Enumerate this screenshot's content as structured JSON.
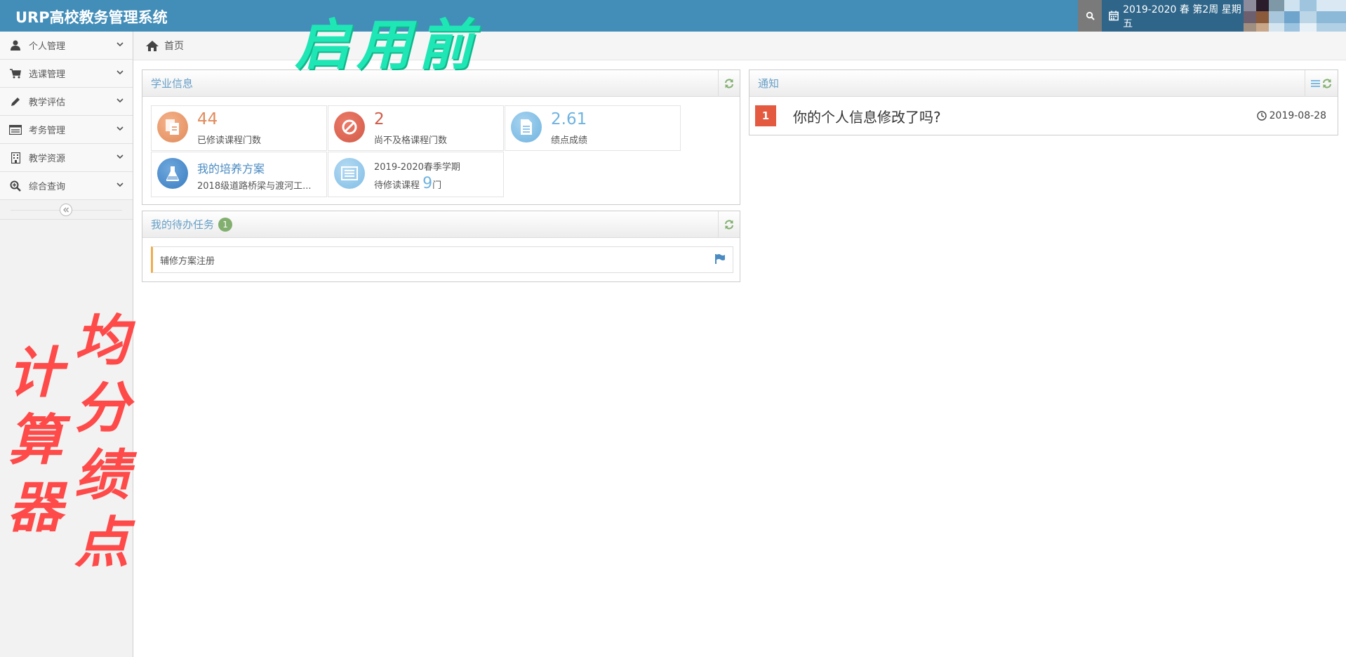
{
  "app": {
    "title": "URP高校教务管理系统"
  },
  "header": {
    "date_text": "2019-2020 春 第2周 星期五"
  },
  "sidebar": {
    "items": [
      {
        "label": "个人管理",
        "icon": "user-icon"
      },
      {
        "label": "选课管理",
        "icon": "cart-icon"
      },
      {
        "label": "教学评估",
        "icon": "pencil-icon"
      },
      {
        "label": "考务管理",
        "icon": "list-alt-icon"
      },
      {
        "label": "教学资源",
        "icon": "building-icon"
      },
      {
        "label": "综合查询",
        "icon": "zoom-in-icon"
      }
    ]
  },
  "breadcrumb": {
    "home": "首页"
  },
  "academic": {
    "title": "学业信息",
    "courses_taken": {
      "value": "44",
      "label": "已修读课程门数"
    },
    "failed": {
      "value": "2",
      "label": "尚不及格课程门数"
    },
    "gpa": {
      "value": "2.61",
      "label": "绩点成绩"
    },
    "plan": {
      "title": "我的培养方案",
      "subtitle": "2018级道路桥梁与渡河工..."
    },
    "term": {
      "title": "2019-2020春季学期",
      "prefix": "待修读课程",
      "count": "9",
      "unit": "门"
    }
  },
  "tasks": {
    "title": "我的待办任务",
    "count": "1",
    "items": [
      "辅修方案注册"
    ]
  },
  "notice": {
    "title": "通知",
    "item": {
      "num": "1",
      "title": "你的个人信息修改了吗?",
      "date": "2019-08-28"
    }
  },
  "overlays": {
    "green": "启用前",
    "red_right": [
      "均",
      "分",
      "绩",
      "点"
    ],
    "red_left": [
      "计",
      "算",
      "器"
    ]
  },
  "colors": {
    "header": "#438eb9",
    "orange": "#e08b5a",
    "red": "#d15b47",
    "blue": "#6fb3e0"
  }
}
